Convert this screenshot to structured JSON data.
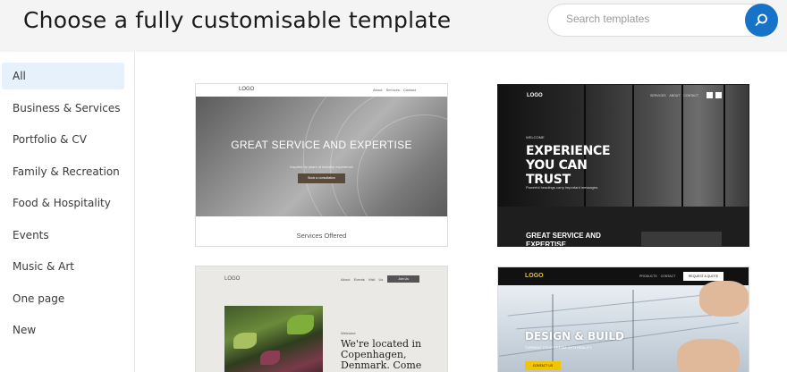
{
  "header": {
    "title": "Choose a fully customisable template",
    "search_placeholder": "Search templates"
  },
  "categories": [
    {
      "label": "All",
      "active": true
    },
    {
      "label": "Business & Services"
    },
    {
      "label": "Portfolio & CV"
    },
    {
      "label": "Family & Recreation"
    },
    {
      "label": "Food & Hospitality"
    },
    {
      "label": "Events"
    },
    {
      "label": "Music & Art"
    },
    {
      "label": "One page"
    },
    {
      "label": "New"
    }
  ],
  "templates": [
    {
      "logo": "LOGO",
      "nav": "About  Services  Contact",
      "headline": "GREAT SERVICE AND EXPERTISE",
      "subline": "Inspired by years of industry experience",
      "cta": "Book a consultation",
      "footer": "Services Offered"
    },
    {
      "logo": "LOGO",
      "nav": "SERVICES  ABOUT  CONTACT",
      "welcome": "WELCOME",
      "headline": "EXPERIENCE YOU CAN TRUST",
      "subline": "Powerful headings carry important messages.",
      "section": "GREAT SERVICE AND EXPERTISE"
    },
    {
      "logo": "LOGO",
      "nav": "About  Events  Visit Us",
      "cta": "Join Us",
      "welcome": "Welcome",
      "headline": "We're located in Copenhagen, Denmark. Come"
    },
    {
      "logo": "LOGO",
      "nav": "PRODUCTS  CONTACT",
      "quote": "REQUEST A QUOTE",
      "headline": "DESIGN & BUILD",
      "subline": "TURNING YOUR DREAM INTO REALITY",
      "cta": "CONTACT US"
    }
  ],
  "colors": {
    "accent": "#1773c7",
    "active_category_bg": "#e6f1fb",
    "header_bg": "#f4f4f5",
    "build_logo": "#f2c500"
  }
}
